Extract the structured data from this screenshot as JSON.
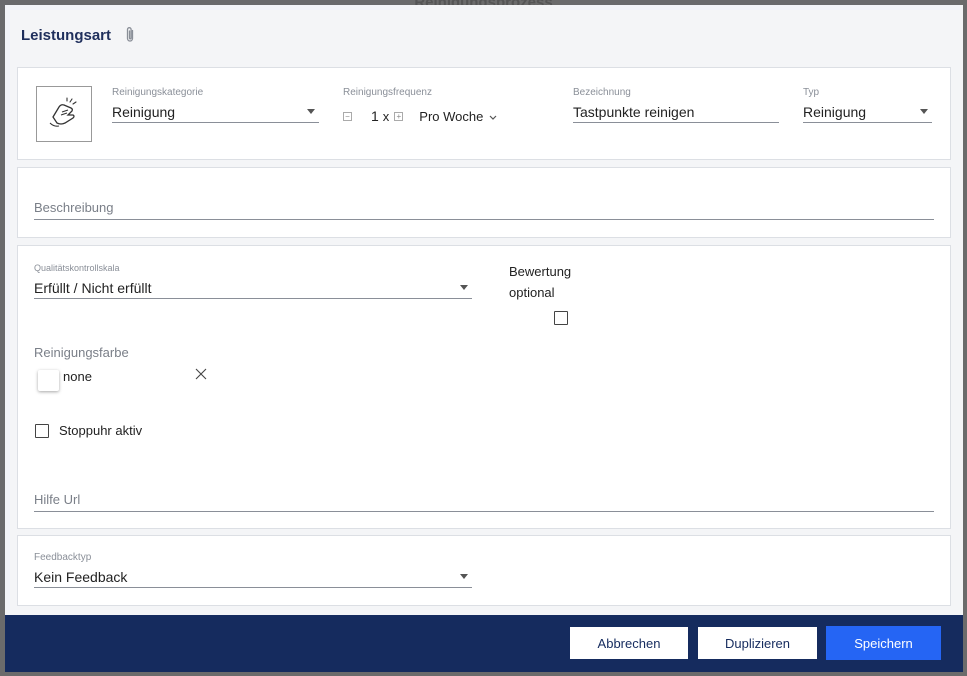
{
  "backdrop": {
    "title": "Reinigungsprozess"
  },
  "dialog": {
    "title": "Leistungsart"
  },
  "card1": {
    "kategorie": {
      "label": "Reinigungskategorie",
      "value": "Reinigung"
    },
    "frequenz": {
      "label": "Reinigungsfrequenz",
      "minus": "−",
      "count": "1",
      "times": "x",
      "plus": "+",
      "unit": "Pro Woche"
    },
    "bezeichnung": {
      "label": "Bezeichnung",
      "value": "Tastpunkte reinigen"
    },
    "typ": {
      "label": "Typ",
      "value": "Reinigung"
    }
  },
  "card2": {
    "beschreibung_placeholder": "Beschreibung"
  },
  "card3": {
    "skala": {
      "label": "Qualitätskontrollskala",
      "value": "Erfüllt / Nicht erfüllt"
    },
    "bewertung_line1": "Bewertung",
    "bewertung_line2": "optional",
    "farbe_label": "Reinigungsfarbe",
    "farbe_value": "none",
    "stoppuhr_label": "Stoppuhr aktiv",
    "hilfe_placeholder": "Hilfe Url"
  },
  "card4": {
    "feedback": {
      "label": "Feedbacktyp",
      "value": "Kein Feedback"
    }
  },
  "footer": {
    "cancel": "Abbrechen",
    "duplicate": "Duplizieren",
    "save": "Speichern"
  },
  "colors": {
    "navy": "#152b5e",
    "primary": "#2565f4",
    "title": "#1f2f5c"
  }
}
